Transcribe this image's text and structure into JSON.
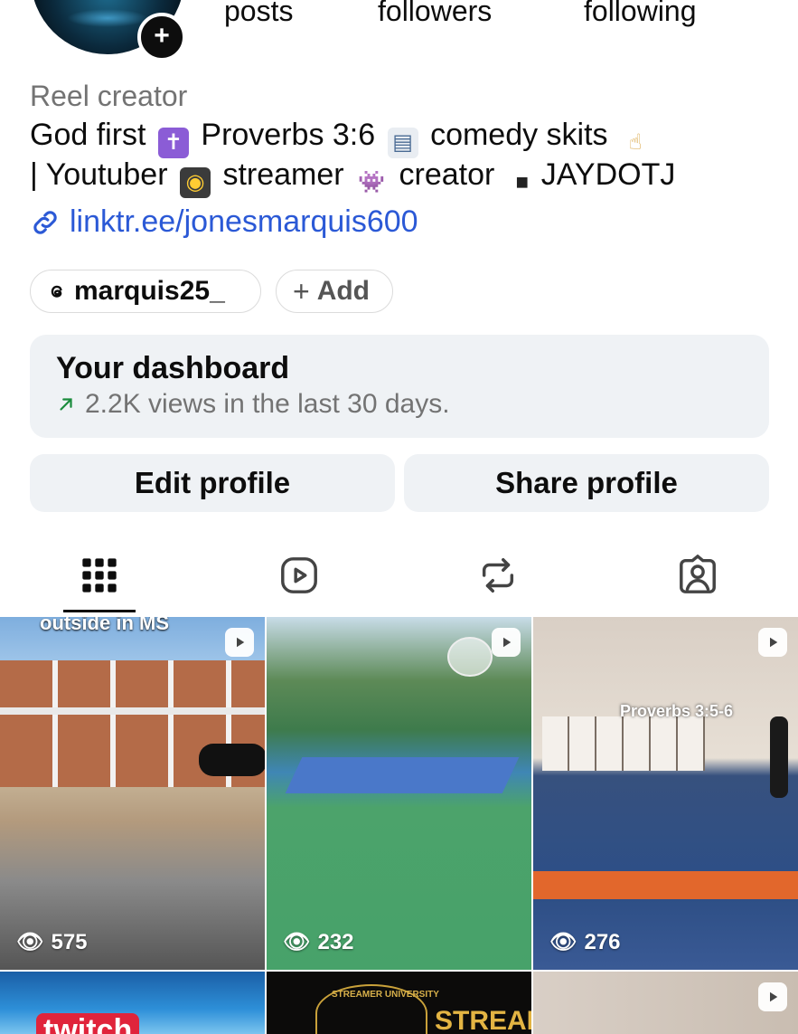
{
  "stats": {
    "posts_label": "posts",
    "followers_label": "followers",
    "following_label": "following"
  },
  "profile": {
    "category": "Reel creator",
    "bio_line1_a": "God first",
    "bio_line1_b": "Proverbs 3:6",
    "bio_line1_c": "comedy skits",
    "bio_line2_a": "| Youtuber",
    "bio_line2_b": "streamer",
    "bio_line2_c": "creator",
    "bio_line2_d": "JAYDOTJ",
    "link": "linktr.ee/jonesmarquis600",
    "threads_handle": "marquis25_",
    "add_label": "Add"
  },
  "dashboard": {
    "title": "Your dashboard",
    "subtitle": "2.2K views in the last 30 days."
  },
  "buttons": {
    "edit": "Edit profile",
    "share": "Share profile"
  },
  "tabs": [
    "grid",
    "reels",
    "reposts",
    "tagged"
  ],
  "grid": [
    {
      "overlay": "outside in MS",
      "views": "575"
    },
    {
      "overlay": "",
      "views": "232"
    },
    {
      "overlay": "Proverbs 3:5-6",
      "views": "276"
    },
    {
      "overlay": "twitch",
      "views": ""
    },
    {
      "overlay": "STREAMER UNIVERSITY",
      "overlay2": "STREAMI",
      "views": ""
    },
    {
      "overlay": "",
      "views": ""
    }
  ],
  "colors": {
    "link": "#2b59d6",
    "muted": "#737373",
    "panel": "#eff2f5",
    "trend": "#1a8b3c"
  },
  "icons": [
    "plus-icon",
    "link-icon",
    "threads-icon",
    "trend-up-icon",
    "grid-icon",
    "reels-icon",
    "repost-icon",
    "tagged-icon",
    "eye-icon",
    "reel-badge-icon"
  ]
}
